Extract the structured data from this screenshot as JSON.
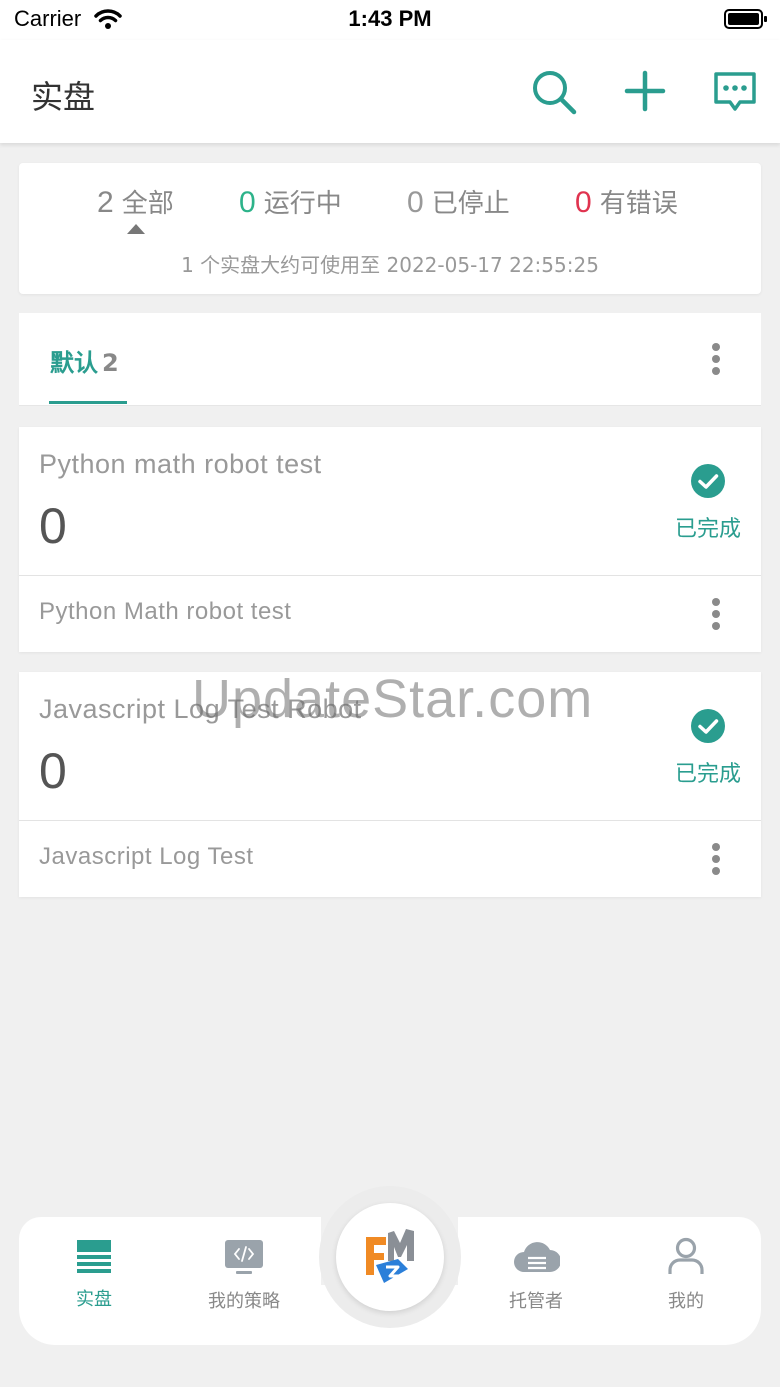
{
  "status_bar": {
    "carrier": "Carrier",
    "time": "1:43 PM"
  },
  "header": {
    "title": "实盘",
    "icons": [
      "search-icon",
      "add-icon",
      "message-icon"
    ]
  },
  "summary": {
    "stats": [
      {
        "count": "2",
        "label": "全部",
        "color": "#888888"
      },
      {
        "count": "0",
        "label": "运行中",
        "color": "#2db38a"
      },
      {
        "count": "0",
        "label": "已停止",
        "color": "#999999"
      },
      {
        "count": "0",
        "label": "有错误",
        "color": "#e0334f"
      }
    ],
    "note": "1 个实盘大约可使用至 2022-05-17 22:55:25"
  },
  "tab": {
    "label": "默认",
    "count": "2"
  },
  "robots": [
    {
      "name": "Python math robot test",
      "value": "0",
      "status": "已完成",
      "description": "Python Math robot test"
    },
    {
      "name": "Javascript Log Test Robot",
      "value": "0",
      "status": "已完成",
      "description": "Javascript Log Test"
    }
  ],
  "bottom_nav": [
    {
      "label": "实盘",
      "icon": "live-trading-icon",
      "active": true
    },
    {
      "label": "我的策略",
      "icon": "code-strategy-icon",
      "active": false
    },
    {
      "label": "托管者",
      "icon": "cloud-icon",
      "active": false
    },
    {
      "label": "我的",
      "icon": "user-icon",
      "active": false
    }
  ],
  "watermark": "UpdateStar.com",
  "accent_color": "#2a9d8f"
}
